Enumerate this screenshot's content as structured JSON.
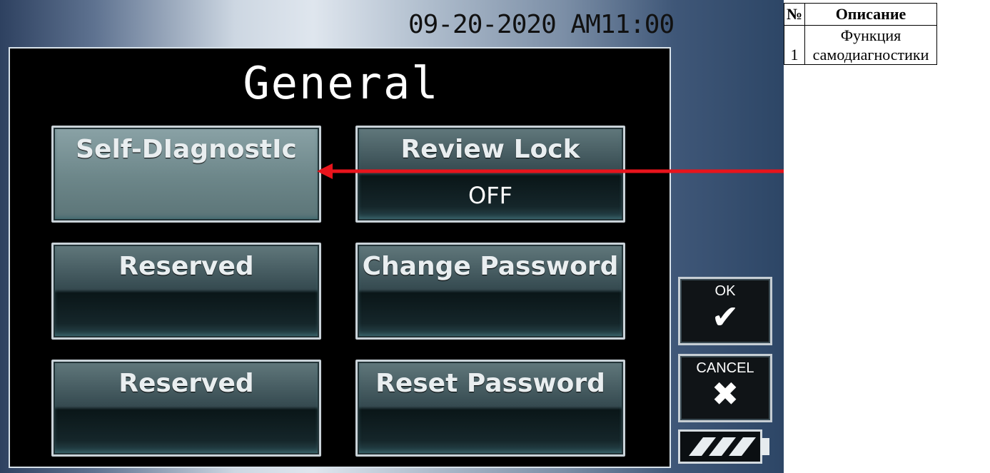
{
  "screen": {
    "datetime": "09-20-2020 AM11:00",
    "title": "General",
    "buttons": [
      {
        "label": "Self-DIagnostIc",
        "value": ""
      },
      {
        "label": "Review Lock",
        "value": "OFF"
      },
      {
        "label": "Reserved",
        "value": ""
      },
      {
        "label": "Change Password",
        "value": ""
      },
      {
        "label": "Reserved",
        "value": ""
      },
      {
        "label": "Reset Password",
        "value": ""
      }
    ],
    "ok": {
      "label": "OK",
      "icon": "checkmark-icon",
      "glyph": "✔"
    },
    "cancel": {
      "label": "CANCEL",
      "icon": "cross-icon",
      "glyph": "✖"
    },
    "battery": {
      "icon": "battery-icon",
      "level": 0.75
    }
  },
  "annotation": {
    "arrow_color": "#e8141c"
  },
  "table": {
    "headers": [
      "№",
      "Описание"
    ],
    "rows": [
      {
        "num": "1",
        "desc_line1": "Функция",
        "desc_line2": "самодиагностики"
      }
    ]
  }
}
